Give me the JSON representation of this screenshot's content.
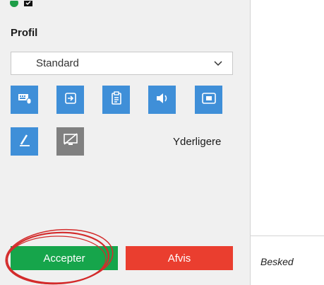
{
  "profile": {
    "title": "Profil",
    "selected": "Standard"
  },
  "toolbar": {
    "buttons": [
      {
        "icon": "keyboard-mouse-icon"
      },
      {
        "icon": "enter-icon"
      },
      {
        "icon": "clipboard-icon"
      },
      {
        "icon": "speaker-icon"
      },
      {
        "icon": "camera-icon"
      },
      {
        "icon": "pen-icon"
      },
      {
        "icon": "screen-off-icon"
      }
    ],
    "more_label": "Yderligere"
  },
  "actions": {
    "accept_label": "Accepter",
    "reject_label": "Afvis"
  },
  "message": {
    "label": "Besked"
  },
  "colors": {
    "accent_blue": "#3f8fd8",
    "accept_green": "#16a54b",
    "reject_red": "#ea3e2f",
    "highlight_red": "#d32b2b"
  }
}
